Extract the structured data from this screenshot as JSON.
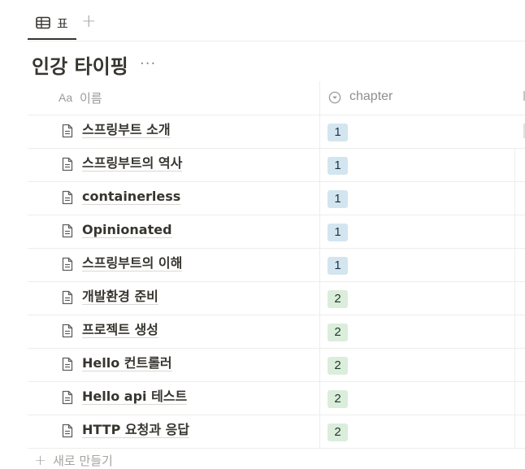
{
  "tabs": {
    "active_tab": {
      "label": "표",
      "icon": "table-icon"
    },
    "add_view_label": "+"
  },
  "title": "인강 타이핑",
  "more_label": "···",
  "columns": {
    "name": {
      "icon_label": "Aa",
      "label": "이름"
    },
    "chapter": {
      "icon": "select-icon",
      "label": "chapter"
    }
  },
  "rows": [
    {
      "name": "스프링부트 소개",
      "chapter": "1"
    },
    {
      "name": "스프링부트의 역사",
      "chapter": "1"
    },
    {
      "name": "containerless",
      "chapter": "1"
    },
    {
      "name": "Opinionated",
      "chapter": "1"
    },
    {
      "name": "스프링부트의 이해",
      "chapter": "1"
    },
    {
      "name": "개발환경 준비",
      "chapter": "2"
    },
    {
      "name": "프로젝트 생성",
      "chapter": "2"
    },
    {
      "name": "Hello 컨트롤러",
      "chapter": "2"
    },
    {
      "name": "Hello api 테스트",
      "chapter": "2"
    },
    {
      "name": "HTTP 요청과 응답",
      "chapter": "2"
    }
  ],
  "new_row": {
    "plus": "+",
    "label": "새로 만들기"
  },
  "colors": {
    "chapter_1_bg": "#d3e5ef",
    "chapter_2_bg": "#dbeddb",
    "text": "#37352f",
    "muted": "#9b9a97"
  }
}
